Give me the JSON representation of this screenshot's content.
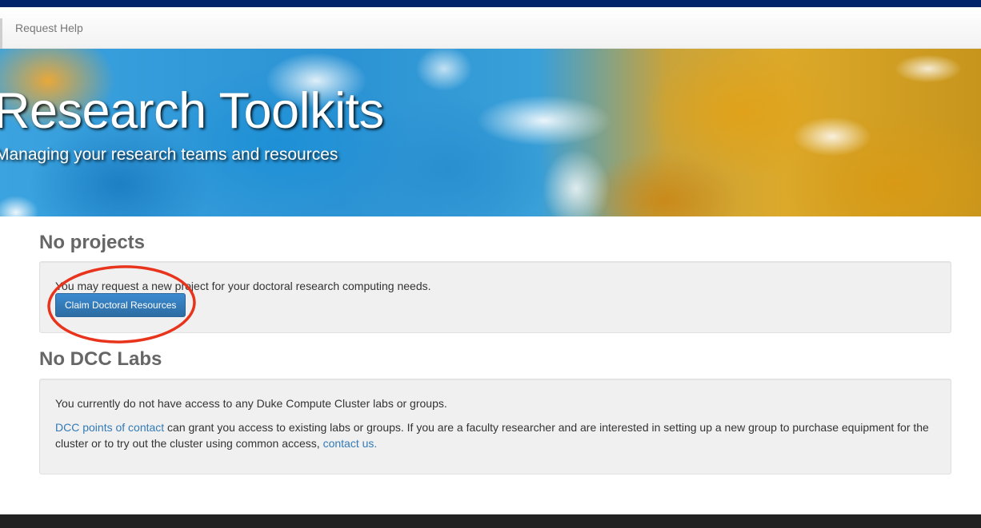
{
  "nav": {
    "request_help": "Request Help"
  },
  "hero": {
    "title": "Research Toolkits",
    "subtitle": "Managing your research teams and resources"
  },
  "projects": {
    "heading": "No projects",
    "message": "You may request a new project for your doctoral research computing needs.",
    "button_label": "Claim Doctoral Resources"
  },
  "labs": {
    "heading": "No DCC Labs",
    "message": "You currently do not have access to any Duke Compute Cluster labs or groups.",
    "contact_link": "DCC points of contact",
    "contact_text": " can grant you access to existing labs or groups. If you are a faculty researcher and are interested in setting up a new group to purchase equipment for the cluster or to try out the cluster using common access, ",
    "contact_us_link": "contact us."
  },
  "colors": {
    "top_bar": "#012169",
    "button": "#337ab7",
    "annotation": "#e8341c",
    "footer": "#222222"
  }
}
